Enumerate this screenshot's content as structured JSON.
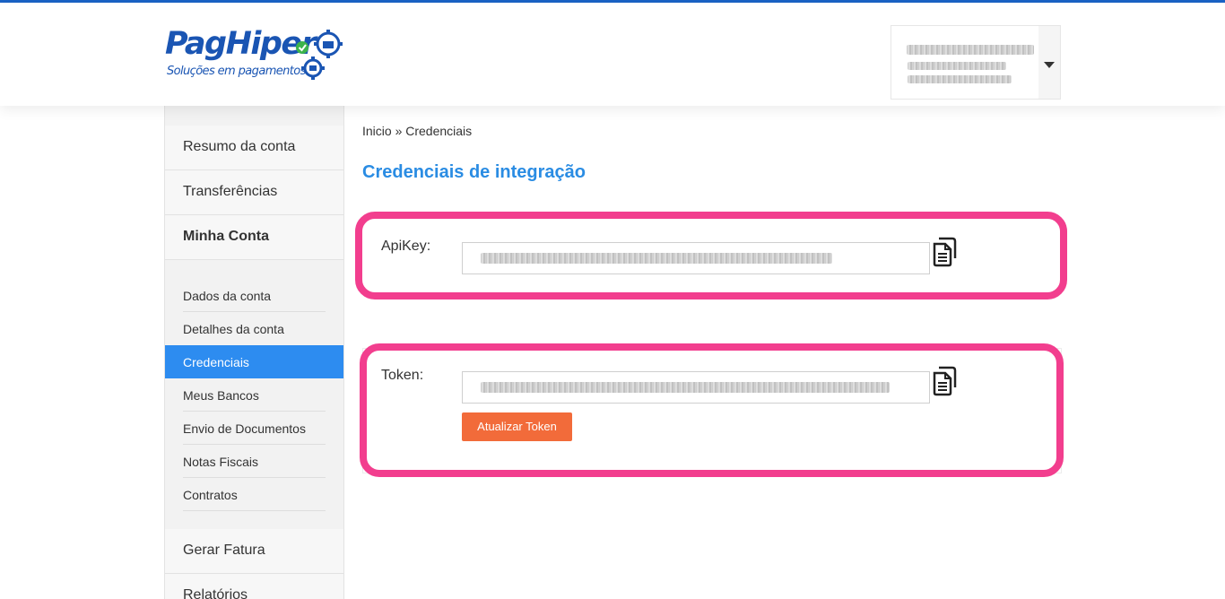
{
  "header": {
    "logo_text": "PagHiper",
    "logo_tagline": "Soluções em pagamentos"
  },
  "user_menu": {
    "dropdown_icon": "caret-down-icon"
  },
  "sidebar": {
    "items": [
      {
        "label": "Resumo da conta"
      },
      {
        "label": "Transferências"
      },
      {
        "label": "Minha Conta"
      }
    ],
    "submenu": [
      {
        "label": "Dados da conta"
      },
      {
        "label": "Detalhes da conta"
      },
      {
        "label": "Credenciais",
        "active": true
      },
      {
        "label": "Meus Bancos"
      },
      {
        "label": "Envio de Documentos"
      },
      {
        "label": "Notas Fiscais"
      },
      {
        "label": "Contratos"
      }
    ],
    "items_after": [
      {
        "label": "Gerar Fatura"
      },
      {
        "label": "Relatórios"
      }
    ]
  },
  "breadcrumb": "Inicio » Credenciais",
  "page_title": "Credenciais de integração",
  "apikey": {
    "label": "ApiKey:",
    "copy_icon": "copy-document-icon"
  },
  "token": {
    "label": "Token:",
    "copy_icon": "copy-document-icon",
    "refresh_button": "Atualizar Token"
  },
  "colors": {
    "brand_blue": "#1a55b3",
    "title_blue": "#2a8ce3",
    "active_menu": "#2d8cf0",
    "highlight_pink": "#f23e8e",
    "button_orange": "#f26b3a"
  }
}
